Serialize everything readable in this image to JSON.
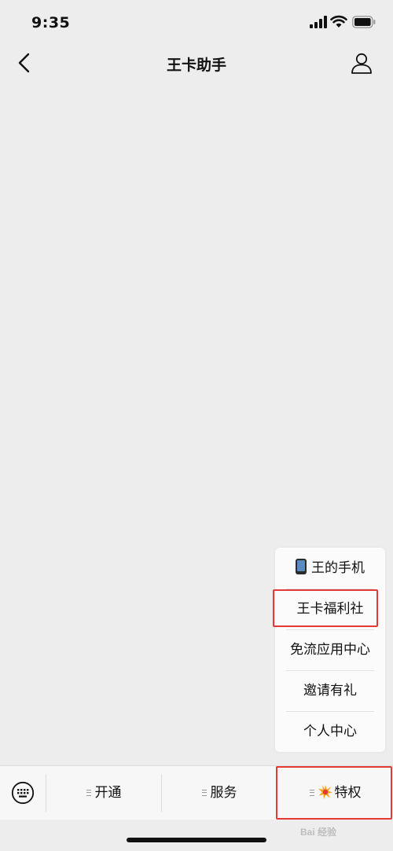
{
  "status_bar": {
    "time": "9:35"
  },
  "header": {
    "title": "王卡助手"
  },
  "popup_menu": {
    "items": [
      {
        "label": "王的手机",
        "icon": "mobile-phone-icon"
      },
      {
        "label": "王卡福利社",
        "highlighted": true
      },
      {
        "label": "免流应用中心"
      },
      {
        "label": "邀请有礼"
      },
      {
        "label": "个人中心"
      }
    ]
  },
  "bottom_menu": {
    "tabs": [
      {
        "label": "开通",
        "icon": "menu-lines-icon"
      },
      {
        "label": "服务",
        "icon": "menu-lines-icon"
      },
      {
        "label": "特权",
        "icon": "collision-burst-icon",
        "highlighted": true
      }
    ]
  },
  "watermark": {
    "text": "Bai 经验"
  },
  "colors": {
    "background": "#ededed",
    "highlight": "#e53935",
    "popup_bg": "#fbfbfb",
    "bottom_bar_bg": "#f7f7f7"
  }
}
